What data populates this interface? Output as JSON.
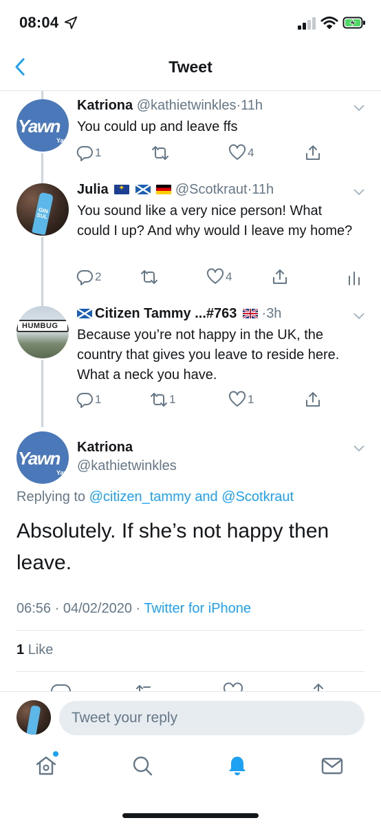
{
  "status_bar": {
    "time": "08:04",
    "location_icon": "location-arrow-icon",
    "signal_icon": "cellular-signal-icon",
    "wifi_icon": "wifi-icon",
    "battery_icon": "battery-charging-icon"
  },
  "nav": {
    "title": "Tweet",
    "back_icon": "chevron-left-icon"
  },
  "tweets": [
    {
      "name": "Katriona",
      "handle": "@kathietwinkles",
      "dot": "·",
      "time": "11h",
      "avatar_text": "Yawn",
      "avatar_small_text": "Yaw",
      "text": "You could up and leave ffs",
      "replies": "1",
      "retweets": "",
      "likes": "4"
    },
    {
      "name": "Julia",
      "flags": [
        "eu-flag",
        "scotland-flag",
        "germany-flag"
      ],
      "handle": "@Scotkraut",
      "dot": "·",
      "time": "11h",
      "avatar_text": "GIN SUL",
      "text": "You sound like a very nice person! What could I up? And why would I leave my home?",
      "replies": "2",
      "retweets": "",
      "likes": "4"
    },
    {
      "name_prefix_flag": "scotland-flag",
      "name": "Citizen Tammy ...#763",
      "name_suffix_flag": "uk-flag",
      "dot": "·",
      "time": "3h",
      "avatar_text": "HUMBUG",
      "text": "Because you’re not happy in the UK, the country that gives you leave to reside here. What a neck you have.",
      "replies": "1",
      "retweets": "1",
      "likes": "1"
    }
  ],
  "main_tweet": {
    "name": "Katriona",
    "handle": "@kathietwinkles",
    "avatar_text": "Yawn",
    "avatar_small_text": "Yaw",
    "replying_prefix": "Replying to",
    "reply_mention_1": "@citizen_tammy",
    "reply_and": "and",
    "reply_mention_2": "@Scotkraut",
    "text": "Absolutely. If she’s not happy then leave.",
    "time": "06:56",
    "date": "04/02/2020",
    "dot": "·",
    "source": "Twitter for iPhone",
    "like_count": "1",
    "like_label": "Like"
  },
  "reply_bar": {
    "placeholder": "Tweet your reply"
  },
  "tab_bar": {
    "items": [
      "home-icon",
      "search-icon",
      "notifications-bell-icon",
      "messages-envelope-icon"
    ],
    "active": "notifications-bell-icon"
  },
  "colors": {
    "accent": "#1da1f2",
    "muted": "#657786",
    "text": "#14171a",
    "divider": "#e1e8ed",
    "input_bg": "#e6ecf0",
    "yawn_avatar": "#4a78b8"
  }
}
